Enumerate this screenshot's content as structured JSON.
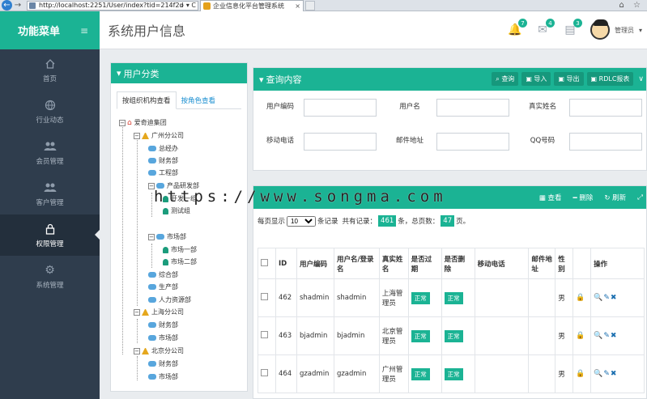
{
  "browser": {
    "url": "http://localhost:2251/User/index?tid=214f2d",
    "url_tools": "⌕ ▾ C",
    "tab_title": "企业信息化平台管理系统",
    "tab_close": "×",
    "right_icons": "⌂ ☆"
  },
  "sidebar": {
    "title": "功能菜单",
    "burger": "≡",
    "items": [
      {
        "label": "首页",
        "icon": "home-icon"
      },
      {
        "label": "行业动态",
        "icon": "globe-icon"
      },
      {
        "label": "会员管理",
        "icon": "users-icon"
      },
      {
        "label": "客户管理",
        "icon": "users-icon"
      },
      {
        "label": "权限管理",
        "icon": "lock-icon"
      },
      {
        "label": "系统管理",
        "icon": "gear-icon"
      }
    ]
  },
  "header": {
    "title": "系统用户信息",
    "badges": [
      "7",
      "4",
      "3"
    ],
    "user": "管理员",
    "user_caret": "▾"
  },
  "left_panel": {
    "title": "用户分类",
    "tabs": [
      "按组织机构查看",
      "按角色查看"
    ],
    "tree": [
      {
        "label": "爱奇迪集团",
        "type": "root",
        "toggle": "−"
      },
      {
        "label": "广州分公司",
        "type": "org",
        "toggle": "−"
      },
      {
        "label": "总经办",
        "type": "dept"
      },
      {
        "label": "财务部",
        "type": "dept"
      },
      {
        "label": "工程部",
        "type": "dept"
      },
      {
        "label": "产品研发部",
        "type": "dept",
        "toggle": "−"
      },
      {
        "label": "开发一组",
        "type": "user"
      },
      {
        "label": "测试组",
        "type": "user"
      },
      {
        "label": "市场部",
        "type": "dept",
        "toggle": "−"
      },
      {
        "label": "市场一部",
        "type": "user"
      },
      {
        "label": "市场二部",
        "type": "user"
      },
      {
        "label": "综合部",
        "type": "dept"
      },
      {
        "label": "生产部",
        "type": "dept"
      },
      {
        "label": "人力资源部",
        "type": "dept"
      },
      {
        "label": "上海分公司",
        "type": "org",
        "toggle": "−"
      },
      {
        "label": "财务部",
        "type": "dept"
      },
      {
        "label": "市场部",
        "type": "dept"
      },
      {
        "label": "北京分公司",
        "type": "org",
        "toggle": "−"
      },
      {
        "label": "财务部",
        "type": "dept"
      },
      {
        "label": "市场部",
        "type": "dept"
      }
    ]
  },
  "query_panel": {
    "title": "查询内容",
    "buttons": [
      "查询",
      "导入",
      "导出",
      "RDLC报表"
    ],
    "collapse": "∨",
    "fields": [
      {
        "label": "用户编码",
        "value": ""
      },
      {
        "label": "用户名",
        "value": ""
      },
      {
        "label": "真实姓名",
        "value": ""
      },
      {
        "label": "移动电话",
        "value": ""
      },
      {
        "label": "邮件地址",
        "value": ""
      },
      {
        "label": "QQ号码",
        "value": ""
      }
    ]
  },
  "table_panel": {
    "buttons": [
      "查看",
      "删除",
      "刷新"
    ],
    "expand": "⤢",
    "pager": {
      "prefix": "每页显示",
      "page_size": "10",
      "suffix": "条记录",
      "total_prefix": "共有记录：",
      "total": "461",
      "total_suffix": "条，总页数：",
      "pages": "47",
      "pages_suffix": "页。"
    },
    "columns": [
      "ID",
      "用户编码",
      "用户名/登录名",
      "真实姓名",
      "是否过期",
      "是否删除",
      "移动电话",
      "邮件地址",
      "性别",
      "",
      "操作"
    ],
    "rows": [
      {
        "id": "462",
        "code": "shadmin",
        "login": "shadmin",
        "name": "上海管理员",
        "expired": "正常",
        "deleted": "正常",
        "phone": "",
        "email": "",
        "gender": "男"
      },
      {
        "id": "463",
        "code": "bjadmin",
        "login": "bjadmin",
        "name": "北京管理员",
        "expired": "正常",
        "deleted": "正常",
        "phone": "",
        "email": "",
        "gender": "男"
      },
      {
        "id": "464",
        "code": "gzadmin",
        "login": "gzadmin",
        "name": "广州管理员",
        "expired": "正常",
        "deleted": "正常",
        "phone": "",
        "email": "",
        "gender": "男"
      }
    ],
    "row_icons": {
      "lock": "🔒",
      "ops": "🔍✎✖"
    }
  },
  "watermark": "https://www.songma.com"
}
